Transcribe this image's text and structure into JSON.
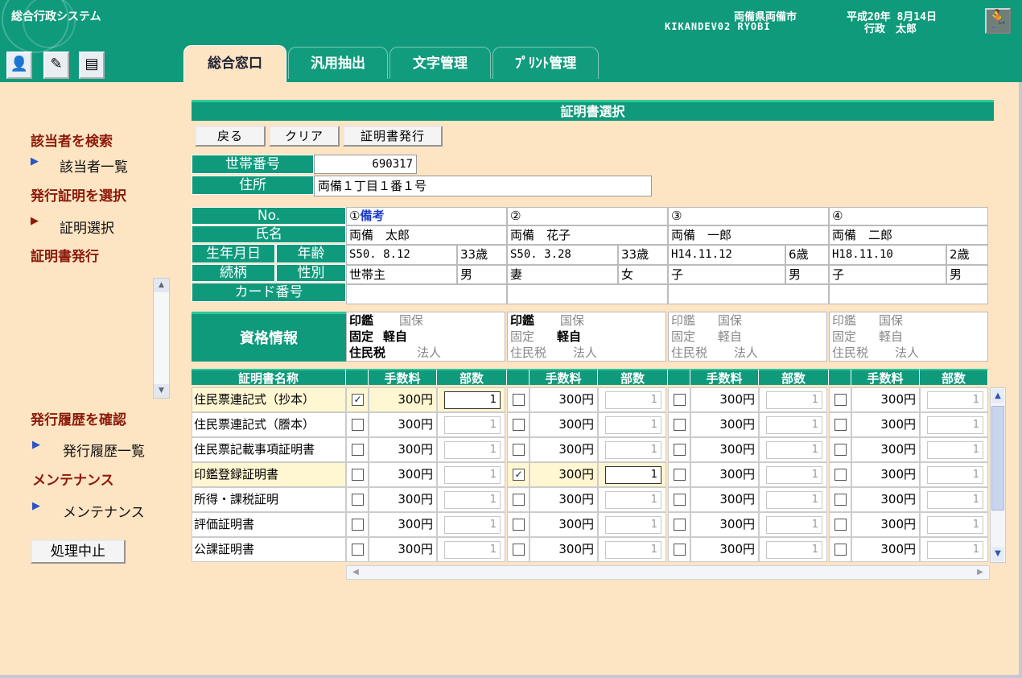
{
  "header": {
    "app_title": "総合行政システム",
    "city": "両備県両備市",
    "date": "平成20年 8月14日",
    "terminal": "KIKANDEV02   RYOBI",
    "user": "行政　太郎"
  },
  "tabs": [
    "総合窓口",
    "汎用抽出",
    "文字管理",
    "ﾌﾟﾘﾝﾄ管理"
  ],
  "sidebar": {
    "search_head": "該当者を検索",
    "search_item": "該当者一覧",
    "select_head": "発行証明を選択",
    "select_item": "証明選択",
    "issue_head": "証明書発行",
    "history_head": "発行履歴を確認",
    "history_item": "発行履歴一覧",
    "maint_head": "メンテナンス",
    "maint_item": "メンテナンス",
    "stop_button": "処理中止"
  },
  "panel": {
    "title": "証明書選択",
    "back": "戻る",
    "clear": "クリア",
    "issue": "証明書発行"
  },
  "household": {
    "number_label": "世帯番号",
    "number": "690317",
    "address_label": "住所",
    "address": "両備１丁目１番１号"
  },
  "labels": {
    "no": "No.",
    "name": "氏名",
    "birth": "生年月日",
    "age": "年齢",
    "relation": "続柄",
    "sex": "性別",
    "card": "カード番号",
    "qualification": "資格情報",
    "cert_name": "証明書名称",
    "fee": "手数料",
    "count": "部数"
  },
  "persons": [
    {
      "no": "①",
      "note": "備考",
      "name": "両備　太郎",
      "birth": "S50. 8.12",
      "age": "33歳",
      "relation": "世帯主",
      "sex": "男",
      "card": ""
    },
    {
      "no": "②",
      "note": "",
      "name": "両備　花子",
      "birth": "S50. 3.28",
      "age": "33歳",
      "relation": "妻",
      "sex": "女",
      "card": ""
    },
    {
      "no": "③",
      "note": "",
      "name": "両備　一郎",
      "birth": "H14.11.12",
      "age": "6歳",
      "relation": "子",
      "sex": "男",
      "card": ""
    },
    {
      "no": "④",
      "note": "",
      "name": "両備　二郎",
      "birth": "H18.11.10",
      "age": "2歳",
      "relation": "子",
      "sex": "男",
      "card": ""
    }
  ],
  "qualifications": {
    "items": [
      "印鑑",
      "国保",
      "固定",
      "軽自",
      "住民税",
      "法人"
    ]
  },
  "certificates": [
    {
      "name": "住民票連記式（抄本）",
      "fee": "300円",
      "checks": [
        true,
        false,
        false,
        false
      ],
      "counts": [
        "1",
        "1",
        "1",
        "1"
      ]
    },
    {
      "name": "住民票連記式（謄本）",
      "fee": "300円",
      "checks": [
        false,
        false,
        false,
        false
      ],
      "counts": [
        "1",
        "1",
        "1",
        "1"
      ]
    },
    {
      "name": "住民票記載事項証明書",
      "fee": "300円",
      "checks": [
        false,
        false,
        false,
        false
      ],
      "counts": [
        "1",
        "1",
        "1",
        "1"
      ]
    },
    {
      "name": "印鑑登録証明書",
      "fee": "300円",
      "checks": [
        false,
        true,
        false,
        false
      ],
      "counts": [
        "1",
        "1",
        "1",
        "1"
      ]
    },
    {
      "name": "所得・課税証明",
      "fee": "300円",
      "checks": [
        false,
        false,
        false,
        false
      ],
      "counts": [
        "1",
        "1",
        "1",
        "1"
      ]
    },
    {
      "name": "評価証明書",
      "fee": "300円",
      "checks": [
        false,
        false,
        false,
        false
      ],
      "counts": [
        "1",
        "1",
        "1",
        "1"
      ]
    },
    {
      "name": "公課証明書",
      "fee": "300円",
      "checks": [
        false,
        false,
        false,
        false
      ],
      "counts": [
        "1",
        "1",
        "1",
        "1"
      ]
    }
  ],
  "colors": {
    "primary": "#0f9a7c",
    "background": "#fde4c3",
    "highlight": "#fff6d2",
    "sidebar_head": "#8b1a0a"
  }
}
